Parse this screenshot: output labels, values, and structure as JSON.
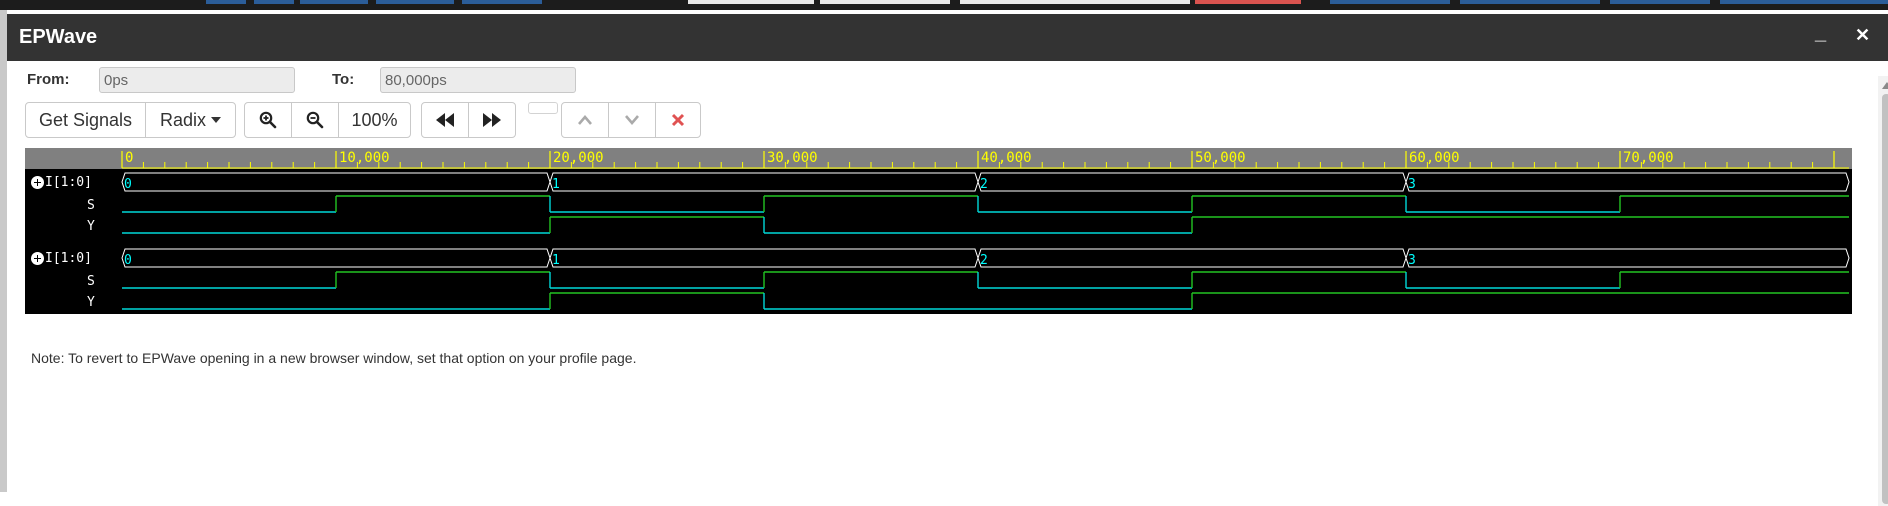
{
  "window": {
    "title": "EPWave",
    "minimize_glyph": "_",
    "close_glyph": "✕"
  },
  "range": {
    "from_label": "From:",
    "from_value": "0ps",
    "to_label": "To:",
    "to_value": "80,000ps"
  },
  "toolbar": {
    "get_signals": "Get Signals",
    "radix": "Radix",
    "zoom_level": "100%",
    "icons": [
      "zoom-in-icon",
      "zoom-out-icon",
      "rewind-icon",
      "fast-forward-icon",
      "chevron-up-icon",
      "chevron-down-icon",
      "close-icon"
    ],
    "remove_color": "#e05252"
  },
  "timeline": {
    "ticks": [
      "0",
      "10,000",
      "20,000",
      "30,000",
      "40,000",
      "50,000",
      "60,000",
      "70,000"
    ],
    "max": 80000,
    "color_ruler": "#808080",
    "color_tick": "#ffff00"
  },
  "groups": [
    {
      "bus": {
        "name": "I[1:0]",
        "values": [
          {
            "t": 0,
            "v": "0"
          },
          {
            "t": 20000,
            "v": "1"
          },
          {
            "t": 40000,
            "v": "2"
          },
          {
            "t": 60000,
            "v": "3"
          }
        ]
      },
      "signals": [
        {
          "name": "S",
          "edges": [
            [
              0,
              0
            ],
            [
              10000,
              1
            ],
            [
              20000,
              0
            ],
            [
              30000,
              1
            ],
            [
              40000,
              0
            ],
            [
              50000,
              1
            ],
            [
              60000,
              0
            ],
            [
              70000,
              1
            ]
          ]
        },
        {
          "name": "Y",
          "edges": [
            [
              0,
              0
            ],
            [
              20000,
              1
            ],
            [
              30000,
              0
            ],
            [
              50000,
              1
            ]
          ]
        }
      ]
    },
    {
      "bus": {
        "name": "I[1:0]",
        "values": [
          {
            "t": 0,
            "v": "0"
          },
          {
            "t": 20000,
            "v": "1"
          },
          {
            "t": 40000,
            "v": "2"
          },
          {
            "t": 60000,
            "v": "3"
          }
        ]
      },
      "signals": [
        {
          "name": "S",
          "edges": [
            [
              0,
              0
            ],
            [
              10000,
              1
            ],
            [
              20000,
              0
            ],
            [
              30000,
              1
            ],
            [
              40000,
              0
            ],
            [
              50000,
              1
            ],
            [
              60000,
              0
            ],
            [
              70000,
              1
            ]
          ]
        },
        {
          "name": "Y",
          "edges": [
            [
              0,
              0
            ],
            [
              20000,
              1
            ],
            [
              30000,
              0
            ],
            [
              50000,
              1
            ]
          ]
        }
      ]
    }
  ],
  "colors": {
    "low": "#00d8d8",
    "high": "#22c422",
    "bus": "#ffffff",
    "bus_text": "#00ffff"
  },
  "note": "Note: To revert to EPWave opening in a new browser window, set that option on your profile page."
}
